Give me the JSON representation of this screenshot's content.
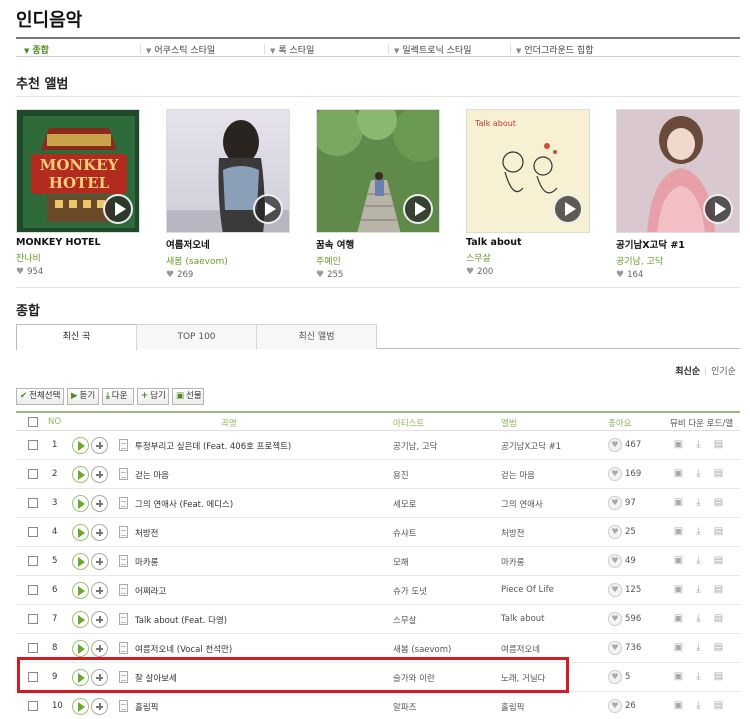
{
  "page": {
    "title": "인디음악"
  },
  "genres": [
    {
      "label": "종합",
      "active": true
    },
    {
      "label": "어쿠스틱 스타일",
      "active": false
    },
    {
      "label": "록 스타일",
      "active": false
    },
    {
      "label": "일렉트로닉 스타일",
      "active": false
    },
    {
      "label": "언더그라운드 힙합",
      "active": false
    }
  ],
  "recommended": {
    "title": "추천 앨범",
    "albums": [
      {
        "title": "MONKEY HOTEL",
        "artist": "잔나비",
        "likes": "954",
        "cover_text": "MONKEY HOTEL"
      },
      {
        "title": "여름저오네",
        "artist": "새봄 (saevom)",
        "likes": "269"
      },
      {
        "title": "꿈속 여행",
        "artist": "주예인",
        "likes": "255"
      },
      {
        "title": "Talk about",
        "artist": "스무살",
        "likes": "200",
        "cover_text": "Talk about"
      },
      {
        "title": "공기남X고닥 #1",
        "artist": "공기남, 고닥",
        "likes": "164"
      }
    ]
  },
  "overall": {
    "title": "종합",
    "tabs": [
      "최신 곡",
      "TOP 100",
      "최신 앨범"
    ],
    "sort": {
      "active": "최신순",
      "other": "인기순"
    },
    "buttons": {
      "select_all": "전체선택",
      "listen": "듣기",
      "download": "다운",
      "add": "담기",
      "gift": "선물"
    },
    "columns": {
      "no": "NO",
      "title": "곡명",
      "artist": "아티스트",
      "album": "앨범",
      "likes": "좋아요",
      "actions": "뮤비 다운 로드/앨"
    }
  },
  "songs": [
    {
      "no": "1",
      "title": "투정부리고 싶은데 (Feat. 406호 프로젝트)",
      "artist": "공기남, 고닥",
      "album": "공기남X고닥 #1",
      "likes": "467"
    },
    {
      "no": "2",
      "title": "걷는 마음",
      "artist": "용진",
      "album": "걷는 마음",
      "likes": "169"
    },
    {
      "no": "3",
      "title": "그의 연애사 (Feat. 에디스)",
      "artist": "세모로",
      "album": "그의 연애사",
      "likes": "97"
    },
    {
      "no": "4",
      "title": "처방전",
      "artist": "슈샤트",
      "album": "처방전",
      "likes": "25"
    },
    {
      "no": "5",
      "title": "마카롱",
      "artist": "모해",
      "album": "마카롱",
      "likes": "49"
    },
    {
      "no": "6",
      "title": "어쩌라고",
      "artist": "슈가 도넛",
      "album": "Piece Of Life",
      "likes": "125"
    },
    {
      "no": "7",
      "title": "Talk about (Feat. 다영)",
      "artist": "스무살",
      "album": "Talk about",
      "likes": "596"
    },
    {
      "no": "8",
      "title": "여름저오네 (Vocal 천석만)",
      "artist": "새봄 (saevom)",
      "album": "여름저오네",
      "likes": "736"
    },
    {
      "no": "9",
      "title": "잘 살아보세",
      "artist": "슬가와 이란",
      "album": "노래, 거닐다",
      "likes": "5"
    },
    {
      "no": "10",
      "title": "홀림픽",
      "artist": "알파즈",
      "album": "홀림픽",
      "likes": "26"
    }
  ],
  "colors": {
    "accent": "#6aa82e",
    "header_green": "#8db65a",
    "highlight_red": "#d51b22"
  }
}
